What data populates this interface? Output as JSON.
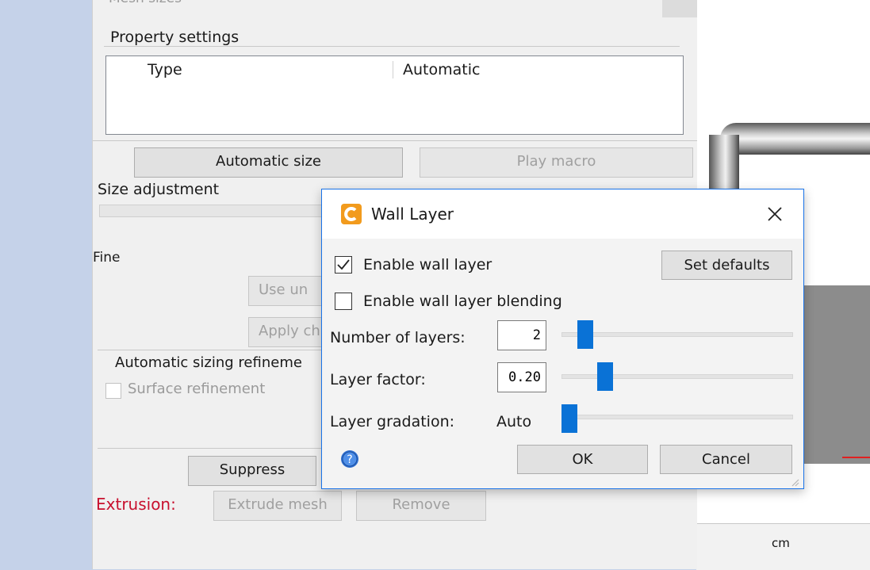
{
  "panel": {
    "clipped_header": "Mesh sizes",
    "property_settings": {
      "label": "Property settings",
      "columns": [
        "Type",
        "Automatic"
      ]
    },
    "automatic_size_label": "Automatic size",
    "play_macro_label": "Play macro",
    "size_adjustment_label": "Size adjustment",
    "fine_label": "Fine",
    "use_button_label": "Use un",
    "apply_button_label": "Apply ch",
    "auto_refine_label": "Automatic sizing refineme",
    "surface_refinement_label": "Surface refinement",
    "suppress_label": "Suppress",
    "extrusion_label": "Extrusion:",
    "extrude_mesh_label": "Extrude mesh",
    "remove_label": "Remove"
  },
  "viewport": {
    "units": "cm"
  },
  "dialog": {
    "title": "Wall Layer",
    "app_icon": "c-logo-icon",
    "close_icon": "close-icon",
    "enable_wall_layer": {
      "label": "Enable wall layer",
      "checked": true
    },
    "enable_blending": {
      "label": "Enable wall layer blending",
      "checked": false
    },
    "set_defaults_label": "Set defaults",
    "number_of_layers": {
      "label": "Number of layers:",
      "value": "2"
    },
    "layer_factor": {
      "label": "Layer factor:",
      "value": "0.20"
    },
    "layer_gradation": {
      "label": "Layer gradation:",
      "value": "Auto"
    },
    "ok_label": "OK",
    "cancel_label": "Cancel",
    "help_icon": "help-icon"
  },
  "colors": {
    "accent": "#0a72d6",
    "error_text": "#c8102e",
    "app_icon": "#f29b1d"
  }
}
